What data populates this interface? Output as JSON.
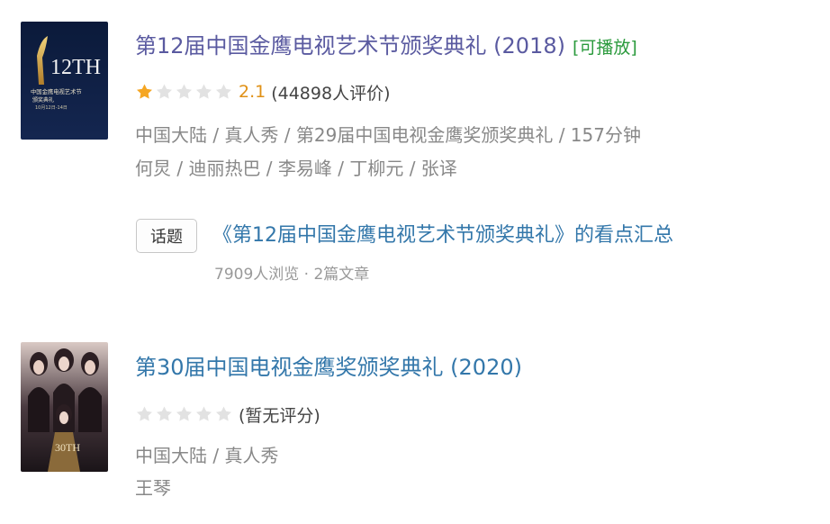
{
  "items": [
    {
      "title": "第12届中国金鹰电视艺术节颁奖典礼 (2018)",
      "playable": "[可播放]",
      "rating": {
        "stars_filled": 1,
        "stars_total": 5,
        "score": "2.1",
        "count": "(44898人评价)"
      },
      "meta_line1": "中国大陆 / 真人秀 / 第29届中国电视金鹰奖颁奖典礼 / 157分钟",
      "meta_line2": "何炅 / 迪丽热巴 / 李易峰 / 丁柳元 / 张译",
      "poster_text": {
        "big": "12TH",
        "line1": "中国金鹰电视艺术节",
        "line2": "颁奖典礼",
        "line3": "10月12日-14日"
      },
      "topic": {
        "tag": "话题",
        "title": "《第12届中国金鹰电视艺术节颁奖典礼》的看点汇总",
        "meta": "7909人浏览 · 2篇文章"
      }
    },
    {
      "title": "第30届中国电视金鹰奖颁奖典礼 (2020)",
      "rating": {
        "stars_filled": 0,
        "stars_total": 5,
        "no_rating": "(暂无评分)"
      },
      "meta_line1": "中国大陆 / 真人秀",
      "meta_line2": "王琴",
      "poster_text": {
        "big": "30TH"
      }
    }
  ],
  "colors": {
    "link": "#3377aa",
    "visited": "#5a5aa0",
    "star": "#f5a623",
    "star_empty": "#e2e2e2",
    "score": "#e09015",
    "playable": "#2a9a3c"
  }
}
